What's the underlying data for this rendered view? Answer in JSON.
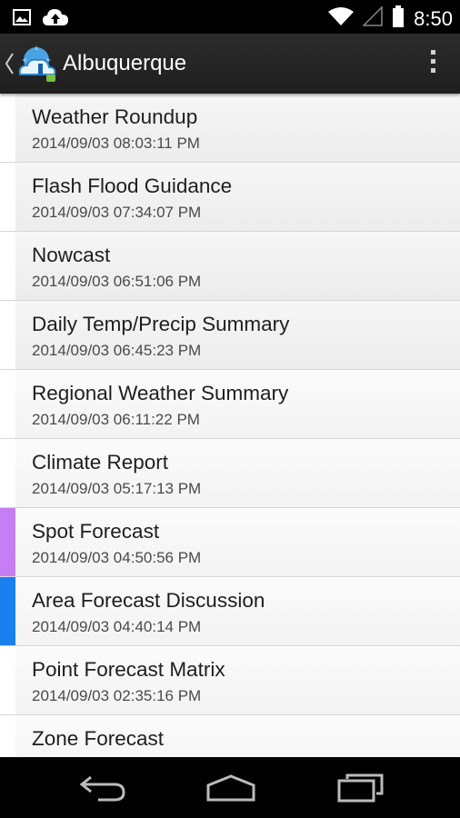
{
  "status_bar": {
    "time": "8:50",
    "icons": [
      "image-notification-icon",
      "cloud-upload-icon",
      "wifi-icon",
      "signal-icon",
      "battery-icon"
    ]
  },
  "action_bar": {
    "title": "Albuquerque",
    "icons": [
      "up-caret-icon",
      "weather-app-icon",
      "overflow-menu-icon"
    ]
  },
  "products": [
    {
      "title": "Weather Roundup",
      "timestamp": "2014/09/03 08:03:11 PM",
      "marker_color": "#ffffff"
    },
    {
      "title": "Flash Flood Guidance",
      "timestamp": "2014/09/03 07:34:07 PM",
      "marker_color": "#ffffff"
    },
    {
      "title": "Nowcast",
      "timestamp": "2014/09/03 06:51:06 PM",
      "marker_color": "#ffffff"
    },
    {
      "title": "Daily Temp/Precip Summary",
      "timestamp": "2014/09/03 06:45:23 PM",
      "marker_color": "#ffffff"
    },
    {
      "title": "Regional Weather Summary",
      "timestamp": "2014/09/03 06:11:22 PM",
      "marker_color": "#ffffff"
    },
    {
      "title": "Climate Report",
      "timestamp": "2014/09/03 05:17:13 PM",
      "marker_color": "#ffffff"
    },
    {
      "title": "Spot Forecast",
      "timestamp": "2014/09/03 04:50:56 PM",
      "marker_color": "#c77df3"
    },
    {
      "title": "Area Forecast Discussion",
      "timestamp": "2014/09/03 04:40:14 PM",
      "marker_color": "#1a80f0"
    },
    {
      "title": "Point Forecast Matrix",
      "timestamp": "2014/09/03 02:35:16 PM",
      "marker_color": "#ffffff"
    },
    {
      "title": "Zone Forecast",
      "timestamp": "",
      "marker_color": "#ffffff"
    }
  ],
  "nav_bar": {
    "icons": [
      "back-icon",
      "home-icon",
      "recent-apps-icon"
    ]
  }
}
